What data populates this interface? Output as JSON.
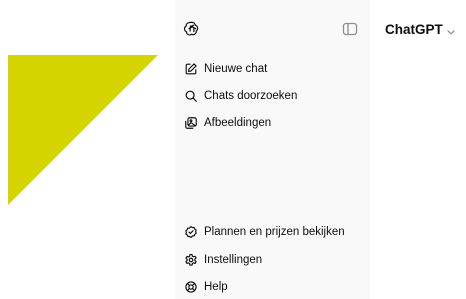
{
  "colors": {
    "accent_triangle": "#d4d400",
    "sidebar_bg": "#f9f9f9",
    "text": "#0d0d0d",
    "muted": "#8e8e8e"
  },
  "sidebar": {
    "logo_icon": "openai-logo-icon",
    "toggle_icon": "sidebar-toggle-icon",
    "top_items": [
      {
        "label": "Nieuwe chat",
        "icon": "pencil-square-icon"
      },
      {
        "label": "Chats doorzoeken",
        "icon": "search-icon"
      },
      {
        "label": "Afbeeldingen",
        "icon": "images-icon"
      }
    ],
    "bottom_items": [
      {
        "label": "Plannen en prijzen bekijken",
        "icon": "badge-check-icon"
      },
      {
        "label": "Instellingen",
        "icon": "gear-icon"
      },
      {
        "label": "Help",
        "icon": "lifebuoy-icon"
      }
    ]
  },
  "header": {
    "model_name": "ChatGPT",
    "model_icon": "chevron-down-icon"
  }
}
